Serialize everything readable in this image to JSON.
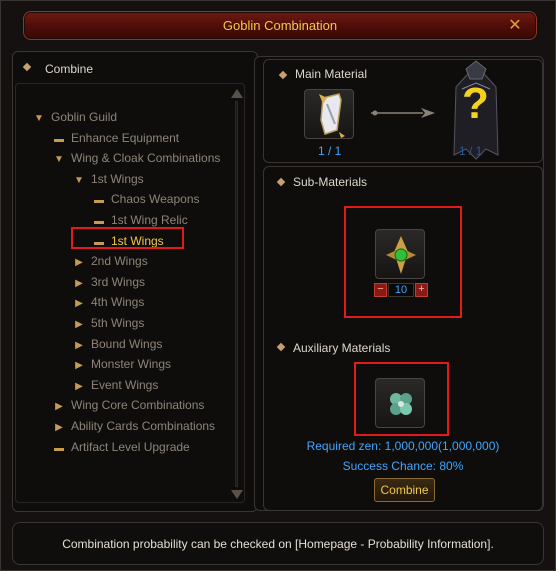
{
  "window": {
    "title": "Goblin Combination"
  },
  "left_panel": {
    "header": "Combine",
    "tree": [
      {
        "label": "Goblin Guild",
        "marker": "down",
        "indent": 0
      },
      {
        "label": "Enhance Equipment",
        "marker": "dash",
        "indent": 1
      },
      {
        "label": "Wing & Cloak Combinations",
        "marker": "down",
        "indent": 1
      },
      {
        "label": "1st Wings",
        "marker": "down",
        "indent": 2
      },
      {
        "label": "Chaos Weapons",
        "marker": "dash",
        "indent": 3
      },
      {
        "label": "1st Wing Relic",
        "marker": "dash",
        "indent": 3
      },
      {
        "label": "1st Wings",
        "marker": "dash",
        "indent": 3,
        "selected": true
      },
      {
        "label": "2nd Wings",
        "marker": "right",
        "indent": 2
      },
      {
        "label": "3rd Wings",
        "marker": "right",
        "indent": 2
      },
      {
        "label": "4th Wings",
        "marker": "right",
        "indent": 2
      },
      {
        "label": "5th Wings",
        "marker": "right",
        "indent": 2
      },
      {
        "label": "Bound Wings",
        "marker": "right",
        "indent": 2
      },
      {
        "label": "Monster Wings",
        "marker": "right",
        "indent": 2
      },
      {
        "label": "Event Wings",
        "marker": "right",
        "indent": 2
      },
      {
        "label": "Wing Core Combinations",
        "marker": "right",
        "indent": 1
      },
      {
        "label": "Ability Cards Combinations",
        "marker": "right",
        "indent": 1
      },
      {
        "label": "Artifact Level Upgrade",
        "marker": "dash",
        "indent": 1
      }
    ]
  },
  "main_material": {
    "header": "Main Material",
    "count": "1 / 1",
    "result_count": "1 / 1",
    "result_symbol": "?"
  },
  "sub_materials": {
    "header": "Sub-Materials",
    "quantity": "10",
    "minus": "−",
    "plus": "+"
  },
  "auxiliary_materials": {
    "header": "Auxiliary Materials"
  },
  "required_zen": "Required zen: 1,000,000(1,000,000)",
  "success_chance": "Success Chance: 80%",
  "combine_button": "Combine",
  "footer": "Combination probability can be checked on [Homepage - Probability Information].",
  "colors": {
    "accent_gold": "#f0c94a",
    "info_blue": "#3fa6ff",
    "highlight_red": "#e01b1b"
  }
}
